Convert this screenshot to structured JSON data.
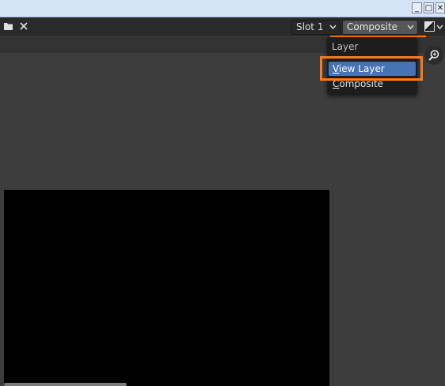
{
  "window": {
    "minimize_label": "_",
    "maximize_label": "□",
    "close_label": "✕"
  },
  "toolbar": {
    "slot_value": "Slot 1",
    "image_value": "Composite",
    "icons": [
      "folder-icon",
      "close-icon",
      "chevron-down-icon",
      "display-mode-icon",
      "zoom-icon"
    ]
  },
  "dropdown": {
    "header": "Layer",
    "items": [
      {
        "label": "View Layer",
        "underline_char": "V",
        "rest": "iew Layer",
        "selected": true
      },
      {
        "label": "Composite",
        "underline_char": "C",
        "rest": "omposite",
        "selected": false
      }
    ]
  },
  "colors": {
    "accent": "#ff7a1a",
    "selection": "#4772b3",
    "background": "#3d3d3d"
  }
}
